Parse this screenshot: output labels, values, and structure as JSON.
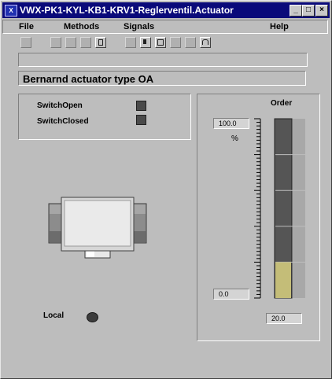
{
  "window": {
    "title": "VWX-PK1-KYL-KB1-KRV1-Reglerventil.Actuator",
    "app_icon_text": "X",
    "minimize_glyph": "_",
    "maximize_glyph": "□",
    "close_glyph": "×"
  },
  "menubar": {
    "items": [
      "File",
      "Methods",
      "Signals",
      "Help"
    ]
  },
  "toolbar": {
    "icons": [
      "tool-1-icon",
      "tool-2-icon",
      "tool-3-icon",
      "tool-4-icon",
      "tool-5-icon",
      "tool-6-icon",
      "tool-7-icon",
      "tool-8-icon",
      "tool-9-icon",
      "tool-10-icon",
      "tool-11-icon"
    ]
  },
  "description": "Bernarnd actuator type OA",
  "switches": {
    "open_label": "SwitchOpen",
    "closed_label": "SwitchClosed"
  },
  "local": {
    "label": "Local"
  },
  "order": {
    "title": "Order",
    "max_value": "100.0",
    "unit": "%",
    "min_value": "0.0",
    "current_value": "20.0",
    "fill_percent": 20,
    "fill_color": "#c4bd78"
  }
}
